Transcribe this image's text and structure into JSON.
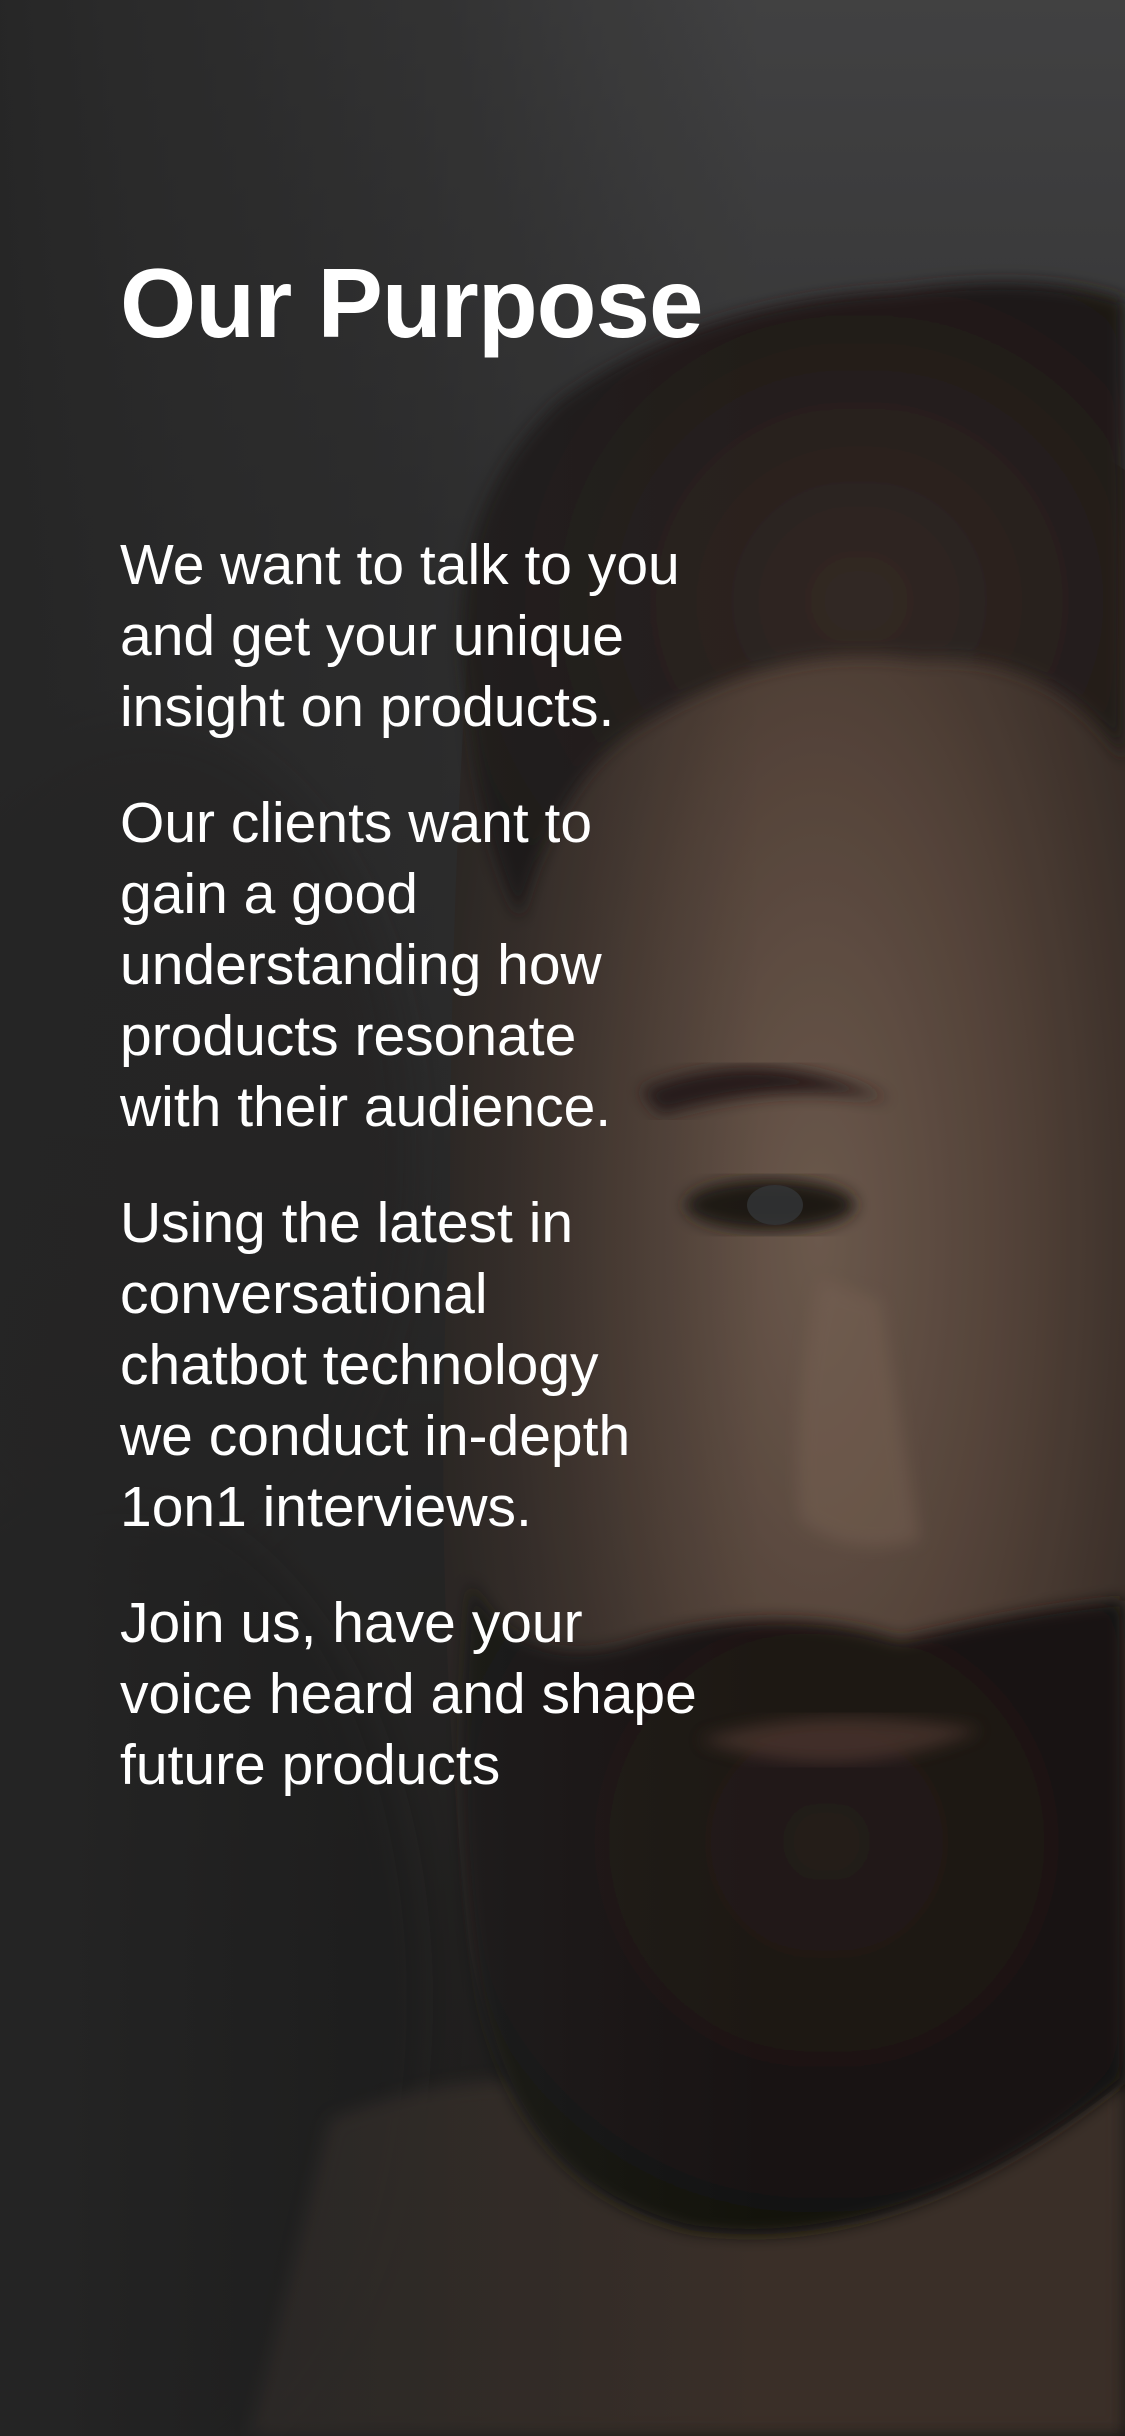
{
  "page": {
    "title": "Our Purpose",
    "paragraphs": [
      "We want to talk to you\nand get your unique\ninsight on products.",
      "Our clients want to\ngain a good\nunderstanding how\nproducts resonate\nwith their audience.",
      "Using the latest in\nconversational\nchatbot technology\nwe conduct in-depth\n1on1 interviews.",
      "Join us, have your\nvoice heard and shape\nfuture products"
    ]
  },
  "background": {
    "image": "portrait-photo-bearded-man",
    "colors": {
      "top": "#4a4a4b",
      "bottom": "#1d1b19",
      "skin": "#6e5a4e",
      "hair": "#2a2220"
    }
  }
}
